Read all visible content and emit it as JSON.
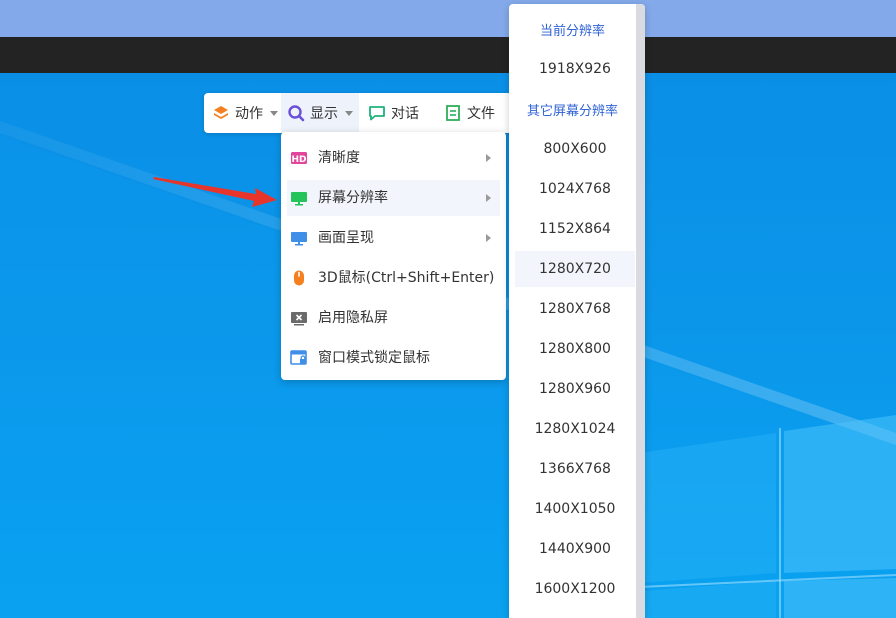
{
  "toolbar": {
    "action_label": "动作",
    "display_label": "显示",
    "chat_label": "对话",
    "file_label": "文件"
  },
  "display_menu": {
    "items": [
      {
        "label": "清晰度",
        "icon": "hd-icon",
        "has_submenu": true
      },
      {
        "label": "屏幕分辨率",
        "icon": "monitor-green-icon",
        "has_submenu": true
      },
      {
        "label": "画面呈现",
        "icon": "monitor-blue-icon",
        "has_submenu": true
      },
      {
        "label": "3D鼠标(Ctrl+Shift+Enter)",
        "icon": "mouse-icon",
        "has_submenu": false
      },
      {
        "label": "启用隐私屏",
        "icon": "privacy-screen-icon",
        "has_submenu": false
      },
      {
        "label": "窗口模式锁定鼠标",
        "icon": "window-lock-icon",
        "has_submenu": false
      }
    ]
  },
  "resolution_menu": {
    "current_header": "当前分辨率",
    "current_value": "1918X926",
    "other_header": "其它屏幕分辨率",
    "options": [
      "800X600",
      "1024X768",
      "1152X864",
      "1280X720",
      "1280X768",
      "1280X800",
      "1280X960",
      "1280X1024",
      "1366X768",
      "1400X1050",
      "1440X900",
      "1600X1200"
    ]
  },
  "colors": {
    "accent": "#2f63d6",
    "desktop_blue": "#0a8be0",
    "arrow_red": "#e8352b"
  }
}
